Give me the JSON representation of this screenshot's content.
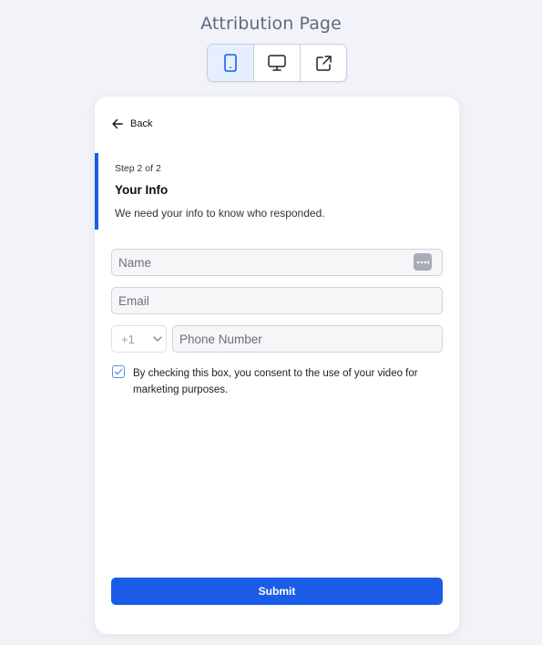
{
  "header": {
    "title": "Attribution Page",
    "view_switcher": {
      "active": "mobile",
      "buttons": [
        {
          "icon": "mobile-icon"
        },
        {
          "icon": "desktop-icon"
        },
        {
          "icon": "external-link-icon"
        }
      ]
    }
  },
  "form": {
    "back_label": "Back",
    "step_label": "Step 2 of 2",
    "title": "Your Info",
    "description": "We need your info to know who responded.",
    "fields": {
      "name_placeholder": "Name",
      "email_placeholder": "Email",
      "country_code": "+1",
      "phone_placeholder": "Phone Number"
    },
    "consent": {
      "checked": true,
      "text": "By checking this box, you consent to the use of your video for marketing purposes."
    },
    "submit_label": "Submit"
  },
  "colors": {
    "accent": "#1a5ce8",
    "background": "#f2f3f8",
    "active_view_bg": "#e6efff"
  }
}
